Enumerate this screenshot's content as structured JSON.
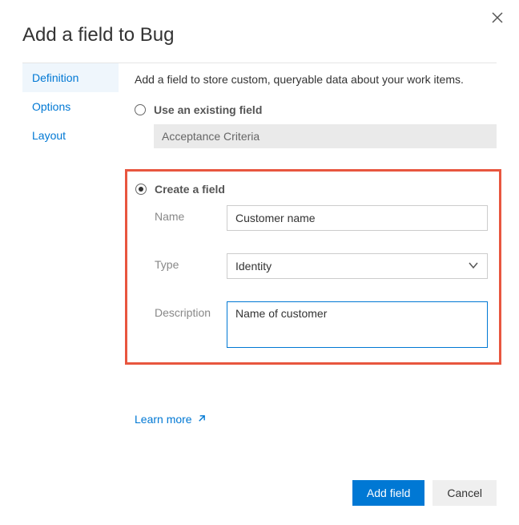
{
  "dialog": {
    "title": "Add a field to Bug"
  },
  "sidebar": {
    "items": [
      {
        "label": "Definition",
        "active": true
      },
      {
        "label": "Options",
        "active": false
      },
      {
        "label": "Layout",
        "active": false
      }
    ]
  },
  "main": {
    "intro": "Add a field to store custom, queryable data about your work items.",
    "option_existing": {
      "label": "Use an existing field",
      "value": "Acceptance Criteria",
      "selected": false
    },
    "option_create": {
      "label": "Create a field",
      "selected": true,
      "fields": {
        "name": {
          "label": "Name",
          "value": "Customer name"
        },
        "type": {
          "label": "Type",
          "value": "Identity"
        },
        "description": {
          "label": "Description",
          "value": "Name of customer"
        }
      }
    },
    "learn_more": "Learn more"
  },
  "footer": {
    "primary": "Add field",
    "secondary": "Cancel"
  }
}
